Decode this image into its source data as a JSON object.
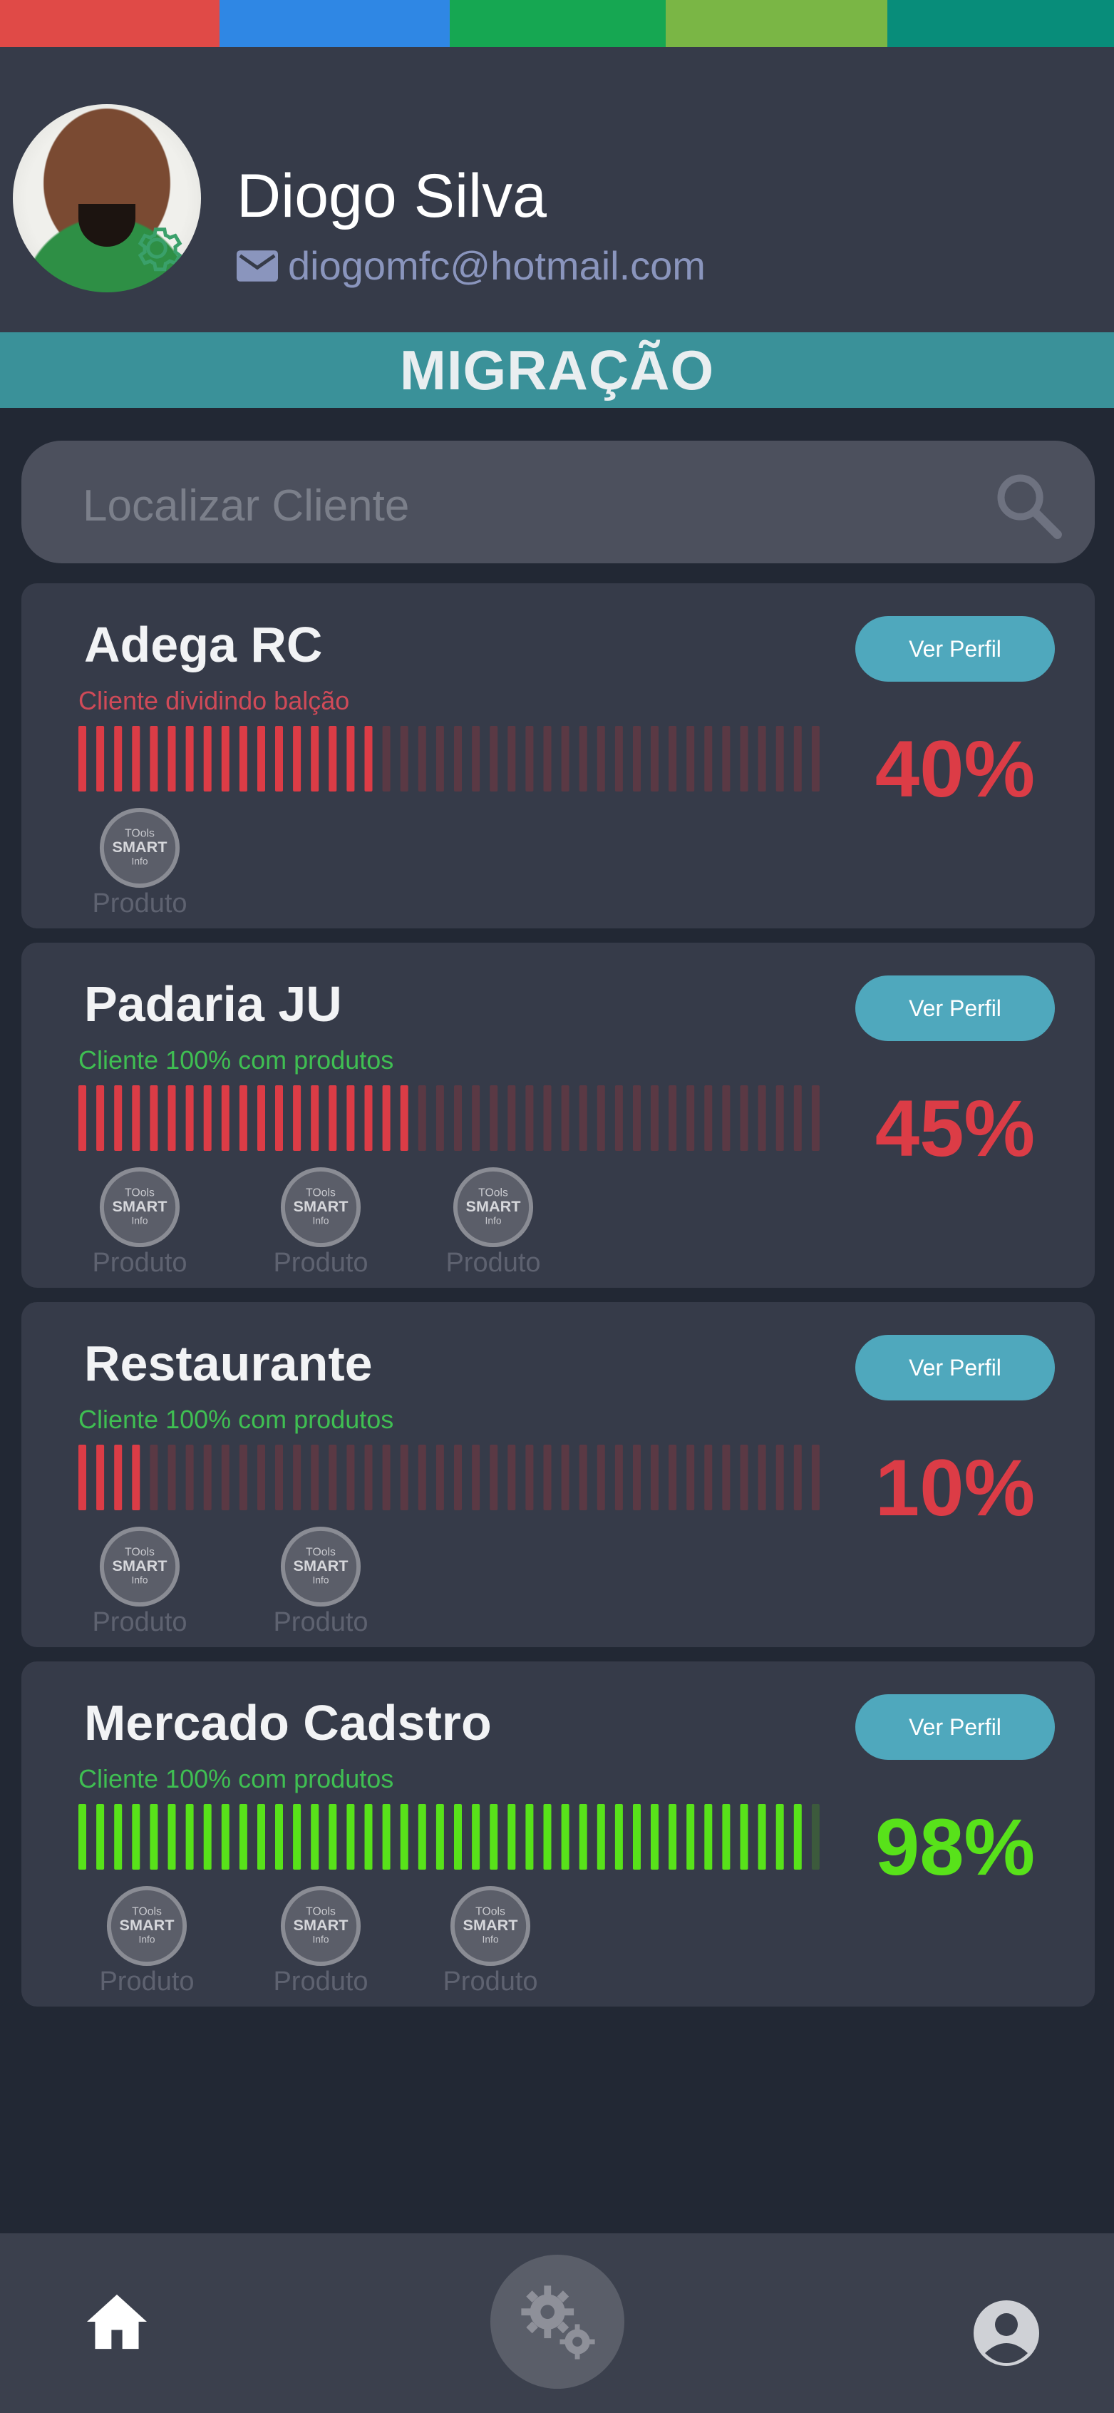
{
  "colors": {
    "stripe": [
      "#e04a47",
      "#2f87e4",
      "#16a752",
      "#7ab645",
      "#088d7a"
    ],
    "section_bar": "#3a9199",
    "button": "#4fa8bd",
    "red": "#dc3c46",
    "green": "#58e21a"
  },
  "user": {
    "name": "Diogo Silva",
    "email": "diogomfc@hotmail.com"
  },
  "section_title": "MIGRAÇÃO",
  "search": {
    "placeholder": "Localizar Cliente"
  },
  "clients": [
    {
      "name": "Adega RC",
      "status": "Cliente dividindo balção",
      "status_color": "#d04a58",
      "button": "Ver Perfil",
      "percent": 40,
      "percent_label": "40%",
      "bar_color": "#dc3c46",
      "bar_dim": "#5a3944",
      "products": [
        "Produto"
      ]
    },
    {
      "name": "Padaria JU",
      "status": "Cliente 100% com produtos",
      "status_color": "#3fbf52",
      "button": "Ver Perfil",
      "percent": 45,
      "percent_label": "45%",
      "bar_color": "#dc3c46",
      "bar_dim": "#5a3944",
      "products": [
        "Produto",
        "Produto",
        "Produto"
      ]
    },
    {
      "name": "Restaurante",
      "status": "Cliente 100% com produtos",
      "status_color": "#3fbf52",
      "button": "Ver Perfil",
      "percent": 10,
      "percent_label": "10%",
      "bar_color": "#dc3c46",
      "bar_dim": "#5a3944",
      "products": [
        "Produto",
        "Produto"
      ]
    },
    {
      "name": "Mercado Cadstro",
      "status": "Cliente 100% com produtos",
      "status_color": "#3fbf52",
      "button": "Ver Perfil",
      "percent": 98,
      "percent_label": "98%",
      "bar_color": "#58e21a",
      "bar_dim": "#3c5a3c",
      "products": [
        "Produto",
        "Produto",
        "Produto"
      ]
    }
  ],
  "product_badge_text": [
    "TOols",
    "SMART",
    "Info"
  ],
  "nav": {
    "left_icon": "home-icon",
    "center_icon": "gears-icon",
    "right_icon": "account-circle-icon"
  }
}
